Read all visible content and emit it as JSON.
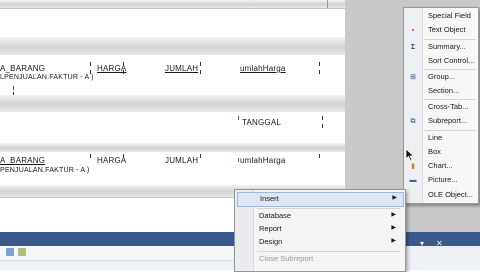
{
  "report": {
    "details_row1": {
      "f1": "A_BARANG",
      "f2": "HARGA",
      "f3": "JUMLAH",
      "f4": "umlahHarga",
      "formula": "LPENJUALAN.FAKTUR - A )"
    },
    "footer_row": {
      "tanggal": "TANGGAL"
    },
    "details_row2": {
      "f1": "A_BARANG",
      "f2": "HARGA",
      "f3": "JUMLAH",
      "f4": "umlahHarga",
      "formula": "PENJUALAN.FAKTUR - A )"
    }
  },
  "insert_submenu": {
    "items": [
      {
        "label": "Special Field",
        "icon": "special-field-icon"
      },
      {
        "label": "Text Object",
        "icon": "text-object-icon"
      },
      {
        "label": "Summary...",
        "icon": "summary-sigma-icon"
      },
      {
        "label": "Sort Control...",
        "icon": ""
      },
      {
        "label": "Group...",
        "icon": "group-icon"
      },
      {
        "label": "Section...",
        "icon": ""
      },
      {
        "label": "Cross-Tab...",
        "icon": ""
      },
      {
        "label": "Subreport...",
        "icon": "subreport-icon"
      },
      {
        "label": "Line",
        "icon": ""
      },
      {
        "label": "Box",
        "icon": ""
      },
      {
        "label": "Chart...",
        "icon": "chart-icon"
      },
      {
        "label": "Picture...",
        "icon": "picture-icon"
      },
      {
        "label": "OLE Object...",
        "icon": ""
      }
    ]
  },
  "context_menu": {
    "items": [
      {
        "label": "Insert",
        "arrow": "▶",
        "highlighted": true
      },
      {
        "label": "Database",
        "arrow": "▶"
      },
      {
        "label": "Report",
        "arrow": "▶"
      },
      {
        "label": "Design",
        "arrow": "▶"
      },
      {
        "label": "Close Subreport",
        "arrow": "",
        "disabled": true
      }
    ]
  },
  "bottom_panel": {
    "controls": [
      "▾",
      "✕"
    ]
  },
  "colors": {
    "menu_highlight": "#dce6f4",
    "panel_caption": "#3a5a8c"
  }
}
